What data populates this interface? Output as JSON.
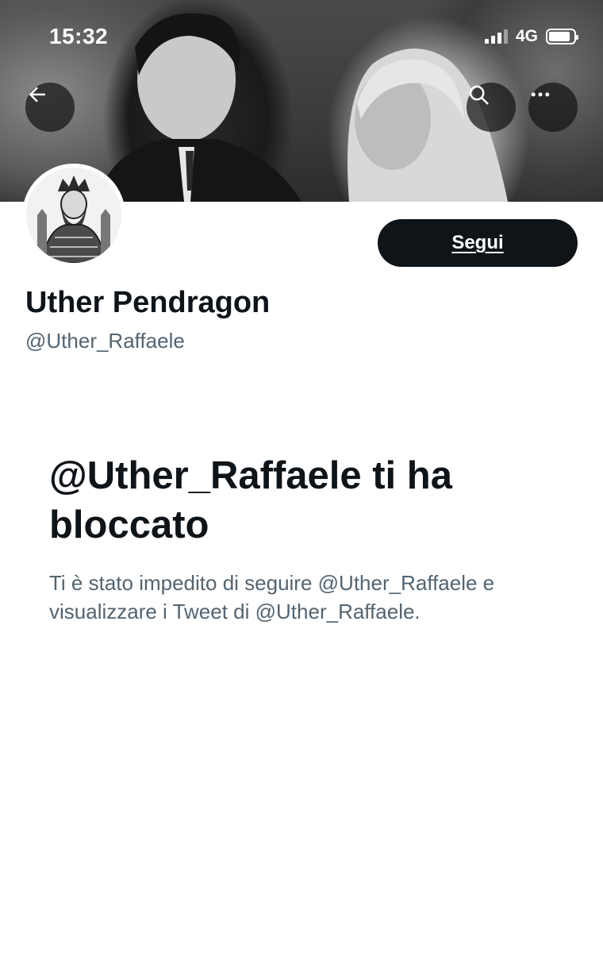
{
  "status_bar": {
    "time": "15:32",
    "network": "4G",
    "battery_level": 0.85
  },
  "header": {
    "back_icon": "arrow-left-icon",
    "search_icon": "search-icon",
    "more_icon": "more-horizontal-icon"
  },
  "profile": {
    "display_name": "Uther Pendragon",
    "handle": "@Uther_Raffaele",
    "follow_label": "Segui"
  },
  "blocked": {
    "title": "@Uther_Raffaele ti ha bloccato",
    "description": "Ti è stato impedito di seguire @Uther_Raffaele e visualizzare i Tweet di @Uther_Raffaele."
  },
  "colors": {
    "primary_text": "#0f1419",
    "secondary_text": "#536471",
    "button_bg": "#0f1419"
  }
}
